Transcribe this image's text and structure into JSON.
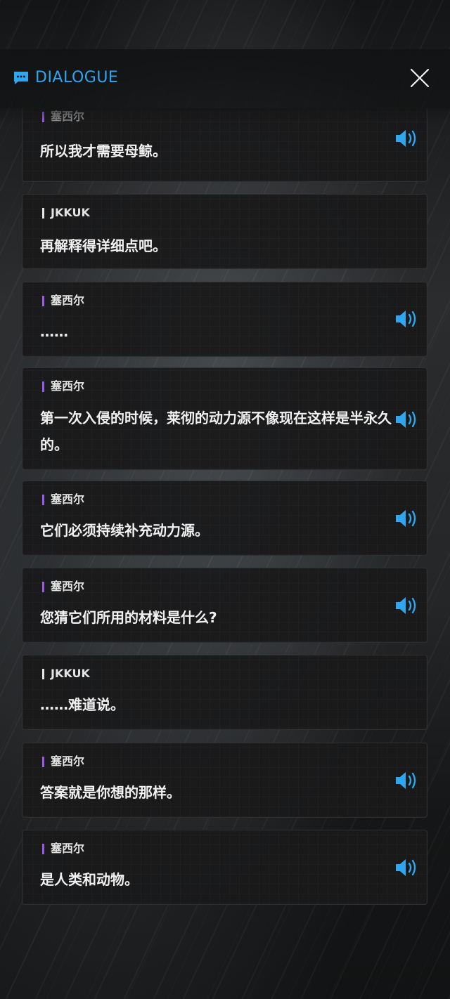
{
  "header": {
    "title": "DIALOGUE",
    "icon": "chat-bubble-icon",
    "accent": "#2fa6f0"
  },
  "close": {
    "icon": "close-icon"
  },
  "colors": {
    "npc_marker": "#9a5ce6",
    "player_marker": "#e6e6e6",
    "voice_icon": "#2fa6f0"
  },
  "messages": [
    {
      "speaker": "塞西尔",
      "text": "所以我才需要母鲸。",
      "voice": true
    },
    {
      "speaker": "JKKUK",
      "text": "再解释得详细点吧。",
      "voice": false
    },
    {
      "speaker": "塞西尔",
      "text": "……",
      "voice": true
    },
    {
      "speaker": "塞西尔",
      "text": "第一次入侵的时候，莱彻的动力源不像现在这样是半永久的。",
      "voice": true
    },
    {
      "speaker": "塞西尔",
      "text": "它们必须持续补充动力源。",
      "voice": true
    },
    {
      "speaker": "塞西尔",
      "text": "您猜它们所用的材料是什么?",
      "voice": true
    },
    {
      "speaker": "JKKUK",
      "text": "……难道说。",
      "voice": false
    },
    {
      "speaker": "塞西尔",
      "text": "答案就是你想的那样。",
      "voice": true
    },
    {
      "speaker": "塞西尔",
      "text": "是人类和动物。",
      "voice": true
    }
  ]
}
